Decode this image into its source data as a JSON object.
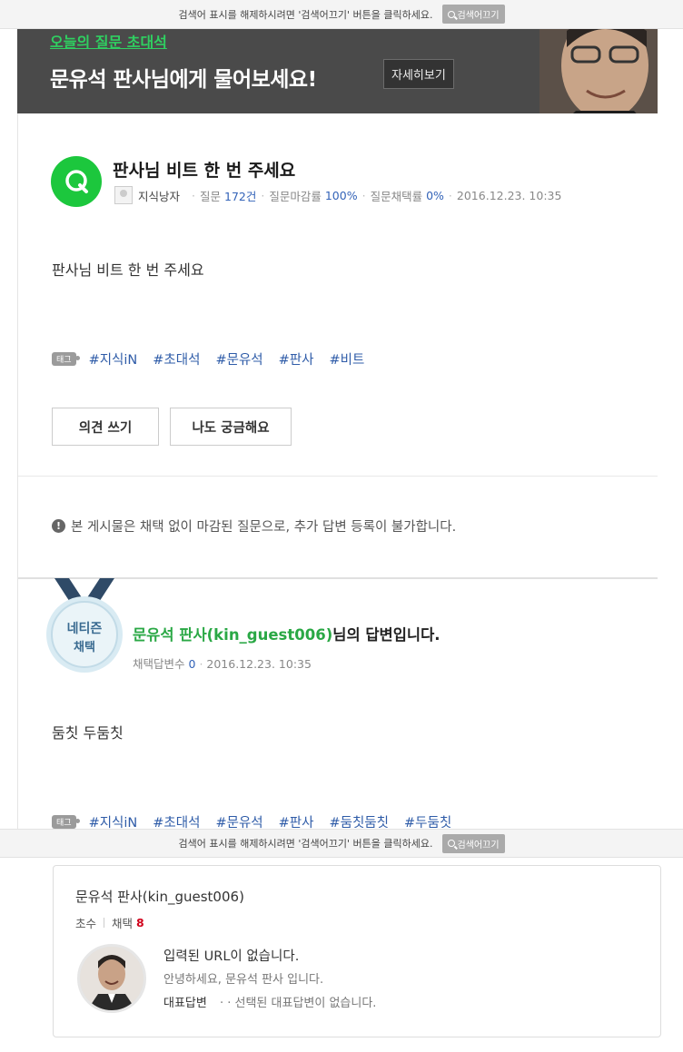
{
  "notice_bar": {
    "text": "검색어 표시를 해제하시려면 '검색어끄기' 버튼을 클릭하세요.",
    "button_label": "검색어끄기"
  },
  "banner": {
    "subtitle": "오늘의 질문 초대석",
    "title": "문유석 판사님에게 물어보세요!",
    "detail_button": "자세히보기"
  },
  "question": {
    "title": "판사님 비트 한 번 주세요",
    "author": "지식낭자",
    "questions_label": "질문",
    "questions_value": "172건",
    "close_rate_label": "질문마감률",
    "close_rate_value": "100%",
    "adopt_rate_label": "질문채택률",
    "adopt_rate_value": "0%",
    "date": "2016.12.23. 10:35",
    "body": "판사님 비트 한 번 주세요",
    "tag_badge": "태그",
    "tags": [
      "#지식iN",
      "#초대석",
      "#문유석",
      "#판사",
      "#비트"
    ],
    "opinion_button": "의견 쓰기",
    "curious_button": "나도 궁금해요",
    "closed_notice": "본 게시물은 채택 없이 마감된 질문으로, 추가 답변 등록이 불가합니다."
  },
  "answer": {
    "medal_line1": "네티즌",
    "medal_line2": "채택",
    "author_name": "문유석 판사(kin_guest006)",
    "title_suffix": "님의 답변입니다.",
    "adopted_label": "채택답변수",
    "adopted_value": "0",
    "date": "2016.12.23. 10:35",
    "body": "둠칫 두둠칫",
    "tag_badge": "태그",
    "tags": [
      "#지식iN",
      "#초대석",
      "#문유석",
      "#판사",
      "#둠칫둠칫",
      "#두둠칫"
    ]
  },
  "profile_card": {
    "name": "문유석 판사(kin_guest006)",
    "level": "초수",
    "adopt_label": "채택",
    "adopt_count": "8",
    "line1": "입력된 URL이 없습니다.",
    "line2": "안녕하세요, 문유석 판사 입니다.",
    "rep_label": "대표답변",
    "rep_text": "· · 선택된 대표답변이 없습니다."
  },
  "colors": {
    "green_q": "#1cc73d",
    "link_blue": "#3363b8",
    "answer_green": "#2aa845",
    "banner_bg": "#4a4a4a",
    "banner_sub": "#2fd061"
  }
}
